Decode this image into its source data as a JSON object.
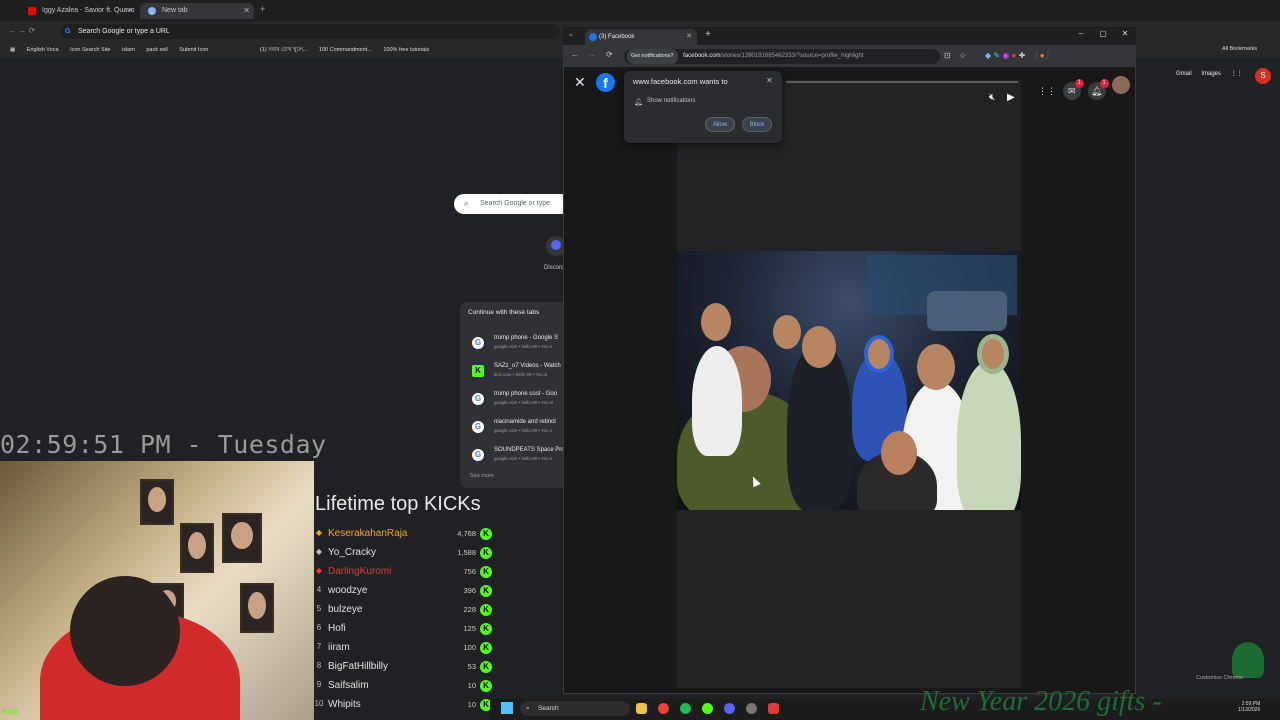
{
  "bg_browser": {
    "tabs": [
      {
        "title": "Iggy Azalea - Savior ft. Quavo",
        "color": "#ff0000"
      },
      {
        "title": "New tab",
        "color": "#8ab4f8"
      }
    ],
    "omnibox": "Search Google or type a URL",
    "bookmarks": [
      "English Voca",
      "Icon Search Site",
      "islam",
      "pack sell",
      "Submit Icon",
      "(1) সবার চোখ খুলে...",
      "100 Commandment...",
      "100% free tutorials"
    ],
    "search_placeholder": "Search Google or type",
    "discord_label": "Discord",
    "right_links": {
      "gmail": "Gmail",
      "images": "Images",
      "user_initial": "S"
    },
    "all_bookmarks": "All Bookmarks",
    "continue": {
      "title": "Continue with these tabs",
      "items": [
        {
          "title": "trump phone - Google S",
          "sub": "google.com • hello 90 • You v"
        },
        {
          "title": "SAZz_o7 Videos - Watch",
          "sub": "kick.com • hello 90 • You vi"
        },
        {
          "title": "trump phone cost - Goo",
          "sub": "google.com • hello 90 • You vi"
        },
        {
          "title": "niacinamide and retinol",
          "sub": "google.com • hello 90 • You v"
        },
        {
          "title": "SOUNDPEATS Space Pro",
          "sub": "google.com • hello 90 • You v"
        }
      ],
      "see_more": "See more"
    },
    "customize": "Customize Chrome"
  },
  "stream_overlay": {
    "clock": "02:59:51 PM - Tuesday",
    "kick_badge": "KICK",
    "top_title": "Lifetime top KICKs",
    "leaders": [
      {
        "name": "KeserakahanRaja",
        "amount": "4,768",
        "rank_color": "#f5a623",
        "name_color": "#f5a623"
      },
      {
        "name": "Yo_Cracky",
        "amount": "1,588",
        "rank_color": "#bdbdbd",
        "name_color": "#e0e0e0"
      },
      {
        "name": "DarlingKuromi",
        "amount": "756",
        "rank_color": "#e53935",
        "name_color": "#e53935"
      },
      {
        "name": "woodzye",
        "amount": "396",
        "rank_color": "",
        "name_color": "#e0e0e0"
      },
      {
        "name": "bulzeye",
        "amount": "228",
        "rank_color": "",
        "name_color": "#e0e0e0"
      },
      {
        "name": "Hofi",
        "amount": "125",
        "rank_color": "",
        "name_color": "#e0e0e0"
      },
      {
        "name": "iiram",
        "amount": "100",
        "rank_color": "",
        "name_color": "#e0e0e0"
      },
      {
        "name": "BigFatHillbilly",
        "amount": "53",
        "rank_color": "",
        "name_color": "#e0e0e0"
      },
      {
        "name": "Saifsalim",
        "amount": "10",
        "rank_color": "",
        "name_color": "#e0e0e0"
      },
      {
        "name": "Whipits",
        "amount": "10",
        "rank_color": "",
        "name_color": "#e0e0e0"
      }
    ],
    "gifts_banner": "New Year 2026 gifts -"
  },
  "fb_browser": {
    "tab_title": "(3) Facebook",
    "get_notifications": "Get notifications?",
    "url_host": "facebook.com",
    "url_path": "/stories/1390191685462333/?source=profile_highlight",
    "notification_prompt": {
      "title": "www.facebook.com wants to",
      "permission": "Show notifications",
      "allow": "Allow",
      "block": "Block"
    },
    "messenger_badge": "",
    "notifications_badge": "1"
  },
  "taskbar": {
    "search": "Search",
    "time": "2:59 PM",
    "date": "1/13/2026"
  },
  "colors": {
    "facebook_blue": "#1877f2",
    "kick_green": "#53fc18",
    "banner_green": "#1e6e3a"
  }
}
